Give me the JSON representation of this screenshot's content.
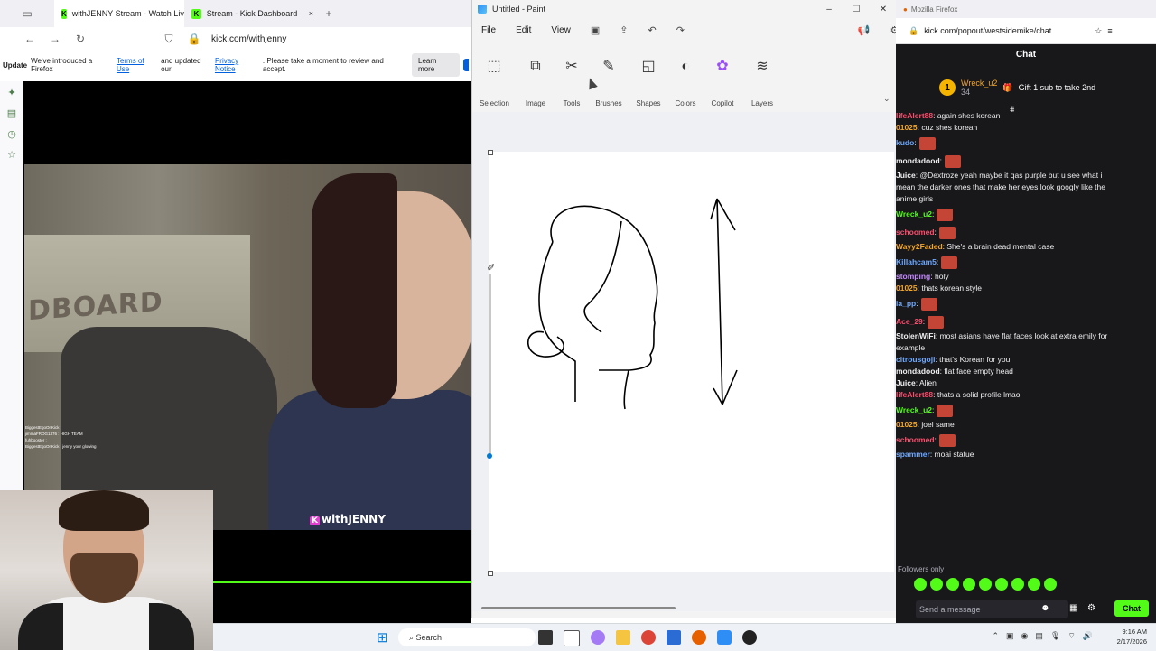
{
  "firefox_left": {
    "tabs": [
      {
        "label": "withJENNY Stream - Watch Live",
        "close": "×"
      },
      {
        "label": "Stream - Kick Dashboard",
        "close": "×"
      }
    ],
    "new_tab": "+",
    "url": "kick.com/withjenny",
    "notice": {
      "bold": "Update",
      "text1": "We've introduced a Firefox",
      "link1": "Terms of Use",
      "text2": "and updated our",
      "link2": "Privacy Notice",
      "text3": ". Please take a moment to review and accept.",
      "button": "Learn more"
    }
  },
  "stream": {
    "board_text": "DBOARD",
    "logo_badge": "K",
    "logo_text": "withJENNY",
    "overlay_chat": [
      "BiggestEgoOnKick : ",
      "jimmaFROG1376 : HIGH TEAM",
      "fuhbooster : ",
      "BiggestEgoOnKick : jenny your glowing"
    ]
  },
  "paint": {
    "title": "Untitled - Paint",
    "menu": [
      "File",
      "Edit",
      "View"
    ],
    "ribbon": [
      "Selection",
      "Image",
      "Tools",
      "Brushes",
      "Shapes",
      "Colors",
      "Copilot",
      "Layers"
    ],
    "win_controls": [
      "–",
      "☐",
      "✕"
    ]
  },
  "firefox_right": {
    "title": "Mozilla Firefox",
    "url": "kick.com/popout/westsidemike/chat",
    "chat_title": "Chat",
    "pinned_user": "Wreck_u2",
    "pinned_count": "34",
    "pinned_text": "Gift 1 sub to take 2nd",
    "followers_only": "Followers only",
    "input_placeholder": "Send a message",
    "chat_button": "Chat"
  },
  "chat_messages": [
    {
      "user": "lifeAlert88",
      "color": "#ff4d6d",
      "text": ": again shes korean"
    },
    {
      "user": "01025",
      "color": "#f5a623",
      "text": ": cuz shes korean"
    },
    {
      "user": "kudo",
      "color": "#6ea8fe",
      "text": ":",
      "emote": true
    },
    {
      "user": "mondadood",
      "color": "#efeff1",
      "text": ":",
      "emote": true
    },
    {
      "user": "Juice",
      "color": "#efeff1",
      "text": ": @Dextroze yeah maybe it qas purple but u see what i"
    },
    {
      "user": "",
      "color": "#efeff1",
      "text": "mean the darker ones that make her eyes look googly like the"
    },
    {
      "user": "",
      "color": "#efeff1",
      "text": "anime girls"
    },
    {
      "user": "Wreck_u2",
      "color": "#53fc18",
      "text": ":",
      "emote": true
    },
    {
      "user": "schoomed",
      "color": "#ff4d6d",
      "text": ":",
      "emote": true
    },
    {
      "user": "Wayy2Faded",
      "color": "#f5a623",
      "text": ": She's a brain dead mental case"
    },
    {
      "user": "Killahcam5",
      "color": "#6ea8fe",
      "text": ":",
      "emote": true
    },
    {
      "user": "stomping",
      "color": "#c58aff",
      "text": ": holy"
    },
    {
      "user": "01025",
      "color": "#f5a623",
      "text": ": thats korean style"
    },
    {
      "user": "ia_pp",
      "color": "#6ea8fe",
      "text": ":",
      "emote": true
    },
    {
      "user": "Ace_29",
      "color": "#ff4d6d",
      "text": ":",
      "emote": true
    },
    {
      "user": "StolenWiFi",
      "color": "#efeff1",
      "text": ": most asians have flat faces look at extra emily for"
    },
    {
      "user": "",
      "color": "#efeff1",
      "text": "example"
    },
    {
      "user": "citrousgoji",
      "color": "#6ea8fe",
      "text": ": that's Korean for you"
    },
    {
      "user": "mondadood",
      "color": "#efeff1",
      "text": ": flat face empty head"
    },
    {
      "user": "Juice",
      "color": "#efeff1",
      "text": ": Alien"
    },
    {
      "user": "lifeAlert88",
      "color": "#ff4d6d",
      "text": ": thats a solid profile lmao"
    },
    {
      "user": "Wreck_u2",
      "color": "#53fc18",
      "text": ":",
      "emote": true
    },
    {
      "user": "01025",
      "color": "#f5a623",
      "text": ": joel same"
    },
    {
      "user": "schoomed",
      "color": "#ff4d6d",
      "text": ":",
      "emote": true
    },
    {
      "user": "spammer",
      "color": "#6ea8fe",
      "text": ": moai statue"
    }
  ],
  "taskbar": {
    "search": "Search",
    "time": "9:16 AM",
    "date": "2/17/2026"
  }
}
